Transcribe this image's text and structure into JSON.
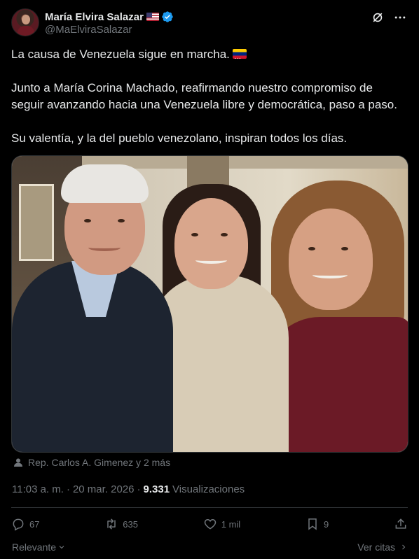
{
  "author": {
    "display_name": "María Elvira Salazar",
    "handle": "@MaElviraSalazar",
    "country_flag": "us-flag",
    "verified": true,
    "verified_color": "#1d9bf0"
  },
  "tweet": {
    "paragraphs": [
      "La causa de Venezuela sigue en marcha.",
      "Junto a María Corina Machado, reafirmando nuestro compromiso de seguir avanzando hacia una Venezuela libre y democrática, paso a paso.",
      "Su valentía, y la del pueblo venezolano, inspiran todos los días."
    ],
    "first_paragraph_emoji": "venezuela-flag"
  },
  "media": {
    "tagged_people": "Rep. Carlos A. Gimenez y 2 más"
  },
  "meta": {
    "time": "11:03 a. m.",
    "separator": "·",
    "date": "20 mar. 2026",
    "views_count": "9.331",
    "views_label": "Visualizaciones"
  },
  "actions": {
    "replies": "67",
    "reposts": "635",
    "likes": "1 mil",
    "bookmarks": "9"
  },
  "footer": {
    "sort_label": "Relevante",
    "quotes_label": "Ver citas"
  },
  "colors": {
    "background": "#000000",
    "text_primary": "#e7e9ea",
    "text_secondary": "#71767b",
    "divider": "#2f3336",
    "accent": "#1d9bf0"
  }
}
